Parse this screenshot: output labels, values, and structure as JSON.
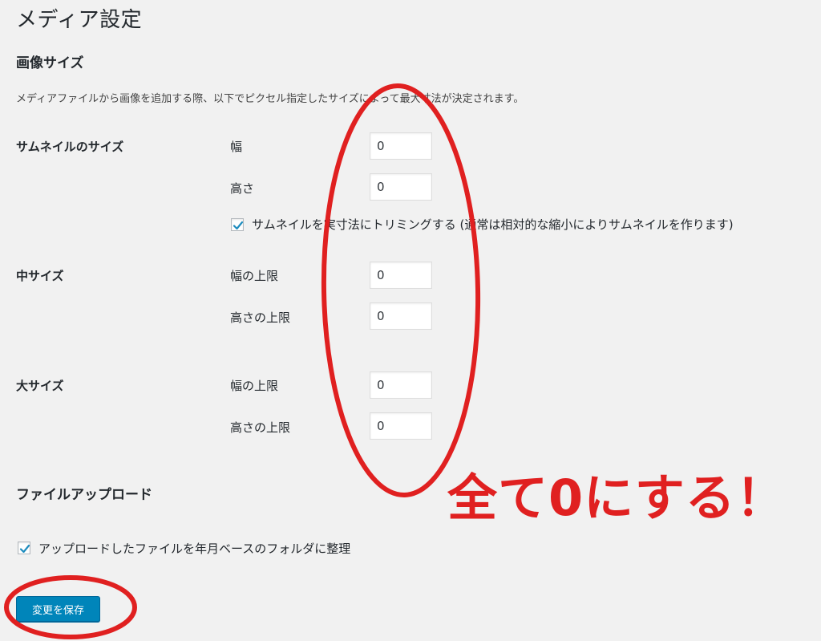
{
  "page": {
    "title": "メディア設定"
  },
  "image_sizes": {
    "heading": "画像サイズ",
    "description": "メディアファイルから画像を追加する際、以下でピクセル指定したサイズによって最大寸法が決定されます。",
    "thumbnail": {
      "label": "サムネイルのサイズ",
      "width_label": "幅",
      "width_value": "0",
      "height_label": "高さ",
      "height_value": "0",
      "crop_checked": true,
      "crop_label": "サムネイルを実寸法にトリミングする (通常は相対的な縮小によりサムネイルを作ります)"
    },
    "medium": {
      "label": "中サイズ",
      "max_width_label": "幅の上限",
      "max_width_value": "0",
      "max_height_label": "高さの上限",
      "max_height_value": "0"
    },
    "large": {
      "label": "大サイズ",
      "max_width_label": "幅の上限",
      "max_width_value": "0",
      "max_height_label": "高さの上限",
      "max_height_value": "0"
    }
  },
  "uploading": {
    "heading": "ファイルアップロード",
    "organize_checked": true,
    "organize_label": "アップロードしたファイルを年月ベースのフォルダに整理"
  },
  "actions": {
    "save_label": "変更を保存"
  },
  "annotation": {
    "text": "全て0にする！",
    "color": "#e02020"
  },
  "colors": {
    "background": "#f1f1f1",
    "primary_button": "#0085ba",
    "checkmark": "#1e8cbe"
  }
}
